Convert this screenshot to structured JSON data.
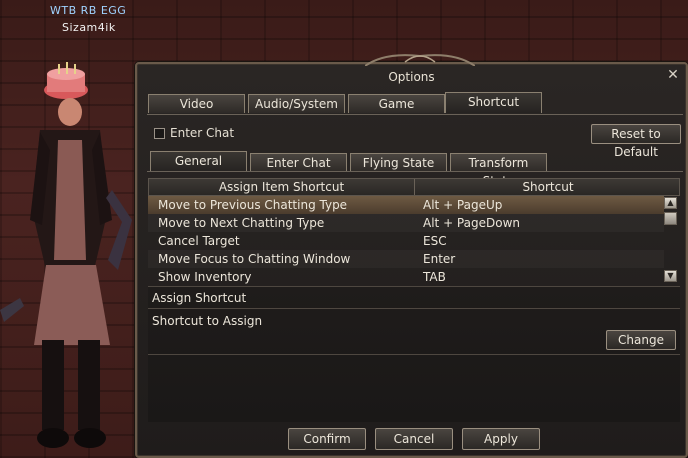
{
  "scene": {
    "player_title": "WTB RB EGG",
    "player_name": "Sizam4ik"
  },
  "window": {
    "title": "Options",
    "close_icon": "close-icon"
  },
  "tabs": [
    {
      "label": "Video",
      "active": false
    },
    {
      "label": "Audio/System",
      "active": false
    },
    {
      "label": "Game",
      "active": false
    },
    {
      "label": "Shortcut",
      "active": true
    }
  ],
  "enter_chat_checkbox": {
    "label": "Enter Chat",
    "checked": false
  },
  "reset_button": "Reset to Default",
  "subtabs": [
    {
      "label": "General",
      "active": true
    },
    {
      "label": "Enter Chat",
      "active": false
    },
    {
      "label": "Flying State",
      "active": false
    },
    {
      "label": "Transform State",
      "active": false
    }
  ],
  "table": {
    "headers": [
      "Assign Item Shortcut",
      "Shortcut"
    ],
    "rows": [
      {
        "action": "Move to Previous Chatting Type",
        "key": "Alt + PageUp",
        "selected": true
      },
      {
        "action": "Move to Next Chatting Type",
        "key": "Alt + PageDown",
        "selected": false
      },
      {
        "action": "Cancel Target",
        "key": "ESC",
        "selected": false
      },
      {
        "action": "Move Focus to Chatting Window",
        "key": "Enter",
        "selected": false
      },
      {
        "action": "Show Inventory",
        "key": "TAB",
        "selected": false
      }
    ]
  },
  "assign": {
    "section_label": "Assign Shortcut",
    "shortcut_label": "Shortcut to Assign",
    "change_button": "Change"
  },
  "footer": {
    "confirm": "Confirm",
    "cancel": "Cancel",
    "apply": "Apply"
  },
  "colors": {
    "accent": "#6e5a43",
    "player_title": "#9fd3ff"
  }
}
